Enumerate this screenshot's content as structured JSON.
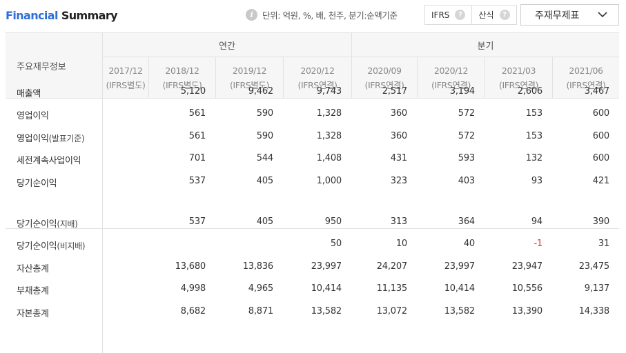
{
  "header": {
    "title_part1": "Financial",
    "title_part2": " Summary",
    "unit_text": "단위: 억원, %, 배, 천주, 분기:순액기준",
    "toggle": [
      {
        "label": "IFRS"
      },
      {
        "label": "산식"
      }
    ],
    "dropdown_value": "주재무제표"
  },
  "table": {
    "row_header": "주요재무정보",
    "groups": {
      "annual": "연간",
      "quarterly": "분기"
    },
    "columns": [
      {
        "period": "2017/12",
        "basis": "(IFRS별도)"
      },
      {
        "period": "2018/12",
        "basis": "(IFRS별도)"
      },
      {
        "period": "2019/12",
        "basis": "(IFRS별도)"
      },
      {
        "period": "2020/12",
        "basis": "(IFRS연결)"
      },
      {
        "period": "2020/09",
        "basis": "(IFRS연결)"
      },
      {
        "period": "2020/12",
        "basis": "(IFRS연결)"
      },
      {
        "period": "2021/03",
        "basis": "(IFRS연결)"
      },
      {
        "period": "2021/06",
        "basis": "(IFRS연결)"
      }
    ],
    "rows": [
      {
        "label": "매출액",
        "sub": "",
        "values": [
          "",
          "5,120",
          "9,462",
          "9,743",
          "2,517",
          "3,194",
          "2,606",
          "3,467"
        ]
      },
      {
        "label": "영업이익",
        "sub": "",
        "values": [
          "",
          "561",
          "590",
          "1,328",
          "360",
          "572",
          "153",
          "600"
        ]
      },
      {
        "label": "영업이익",
        "sub": "(발표기준)",
        "values": [
          "",
          "561",
          "590",
          "1,328",
          "360",
          "572",
          "153",
          "600"
        ]
      },
      {
        "label": "세전계속사업이익",
        "sub": "",
        "values": [
          "",
          "701",
          "544",
          "1,408",
          "431",
          "593",
          "132",
          "600"
        ]
      },
      {
        "label": "당기순이익",
        "sub": "",
        "values": [
          "",
          "537",
          "405",
          "1,000",
          "323",
          "403",
          "93",
          "421"
        ]
      },
      {
        "label": "당기순이익",
        "sub": "(지배)",
        "values": [
          "",
          "537",
          "405",
          "950",
          "313",
          "364",
          "94",
          "390"
        ]
      },
      {
        "label": "당기순이익",
        "sub": "(비지배)",
        "values": [
          "",
          "",
          "",
          "50",
          "10",
          "40",
          "-1",
          "31"
        ]
      },
      {
        "label": "자산총계",
        "sub": "",
        "values": [
          "",
          "13,680",
          "13,836",
          "23,997",
          "24,207",
          "23,997",
          "23,947",
          "23,475"
        ]
      },
      {
        "label": "부채총계",
        "sub": "",
        "values": [
          "",
          "4,998",
          "4,965",
          "10,414",
          "11,135",
          "10,414",
          "10,556",
          "9,137"
        ]
      },
      {
        "label": "자본총계",
        "sub": "",
        "values": [
          "",
          "8,682",
          "8,871",
          "13,582",
          "13,072",
          "13,582",
          "13,390",
          "14,338"
        ]
      }
    ]
  }
}
